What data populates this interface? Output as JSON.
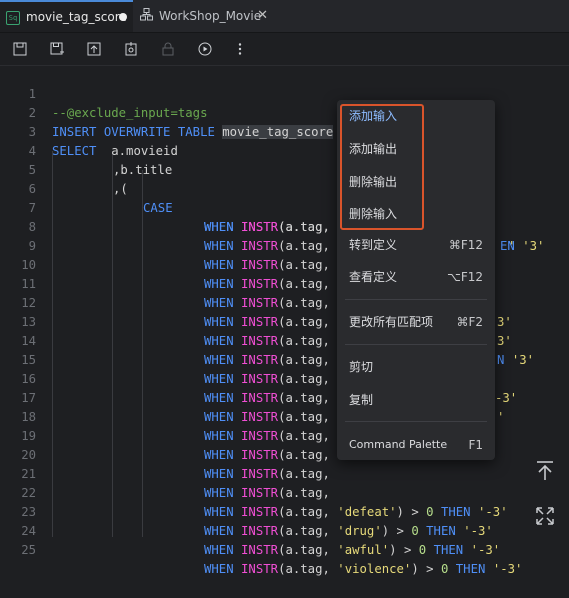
{
  "tabs": [
    {
      "label": "movie_tag_score",
      "icon": "sql-file-icon",
      "active": true,
      "modified": true
    },
    {
      "label": "WorkShop_Movie",
      "icon": "workspace-icon",
      "active": false
    }
  ],
  "toolbar": [
    "save-icon",
    "save-as-icon",
    "upload-icon",
    "commit-icon",
    "lock-icon",
    "run-icon",
    "more-icon"
  ],
  "editor": {
    "line_numbers": [
      "1",
      "2",
      "3",
      "4",
      "5",
      "6",
      "7",
      "8",
      "9",
      "10",
      "11",
      "12",
      "13",
      "14",
      "15",
      "16",
      "17",
      "18",
      "19",
      "20",
      "21",
      "22",
      "23",
      "24",
      "25"
    ],
    "line1": "--@exclude_input=tags",
    "line2_kw": "INSERT OVERWRITE TABLE",
    "line2_table": "movie_tag_score",
    "line3_kw": "SELECT",
    "line3_rest": "  a.movieid",
    "line4": ",b.title",
    "line5": ",(",
    "case_kw": "CASE",
    "when_kw": "WHEN",
    "instr_fn": "INSTR",
    "instr_args": "(a.tag,",
    "then_kw": "THEN",
    "gt": ">",
    "zero": "0",
    "partial": {
      "l6": "'",
      "l7_then": "EN",
      "l7_val": "'3'",
      "l11": "3'",
      "l12": "3'",
      "l13_then": "N",
      "l13_val": "'3'",
      "l15": "-3'",
      "l16": "'"
    },
    "l22_str": "'defeat'",
    "l22_val": "'-3'",
    "l23_str": "'drug'",
    "l23_val": "'-3'",
    "l24_str": "'awful'",
    "l24_val": "'-3'",
    "l25_str": "'violence'",
    "l25_val": "'-3'"
  },
  "context_menu": [
    {
      "label": "添加输入",
      "shortcut": "",
      "highlighted": true
    },
    {
      "label": "添加输出",
      "shortcut": ""
    },
    {
      "label": "删除输出",
      "shortcut": ""
    },
    {
      "label": "删除输入",
      "shortcut": ""
    },
    {
      "label": "转到定义",
      "shortcut": "⌘F12"
    },
    {
      "label": "查看定义",
      "shortcut": "⌥F12"
    },
    {
      "label": "更改所有匹配项",
      "shortcut": "⌘F2"
    },
    {
      "label": "剪切",
      "shortcut": ""
    },
    {
      "label": "复制",
      "shortcut": ""
    },
    {
      "label": "Command Palette",
      "shortcut": "F1"
    }
  ],
  "floating": {
    "top": "⤒",
    "expand": "⤡"
  }
}
